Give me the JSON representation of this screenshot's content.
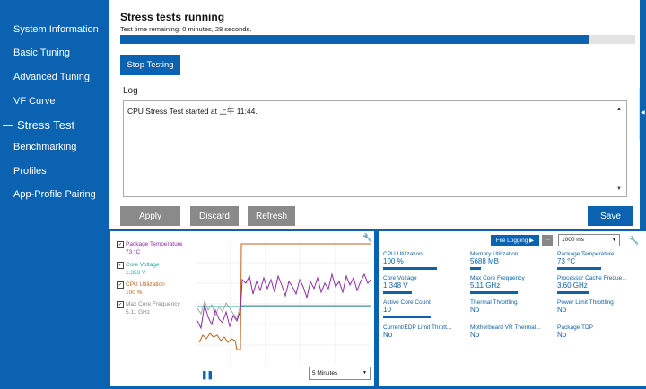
{
  "sidebar": {
    "items": [
      {
        "label": "System Information"
      },
      {
        "label": "Basic Tuning"
      },
      {
        "label": "Advanced Tuning"
      },
      {
        "label": "VF Curve"
      },
      {
        "label": "Stress Test",
        "active": true
      },
      {
        "label": "Benchmarking"
      },
      {
        "label": "Profiles"
      },
      {
        "label": "App-Profile Pairing"
      }
    ]
  },
  "main": {
    "title": "Stress tests running",
    "subtitle": "Test time remaining: 0 minutes, 28 seconds.",
    "progress": 0.91,
    "stop_button": "Stop Testing",
    "log_label": "Log",
    "log_text": "CPU Stress Test started at 上午 11:44."
  },
  "actions": {
    "apply": "Apply",
    "discard": "Discard",
    "refresh": "Refresh",
    "save": "Save"
  },
  "graph": {
    "legend": [
      {
        "name": "Package Temperature",
        "value": "73 °C",
        "color": "#8e2ea3"
      },
      {
        "name": "Core Voltage",
        "value": "1.353 V",
        "color": "#2aa6a0"
      },
      {
        "name": "CPU Utilization",
        "value": "100 %",
        "color": "#c0621c"
      },
      {
        "name": "Max Core Frequency",
        "value": "5.11 GHz",
        "color": "#888888"
      }
    ],
    "duration": "5 Minutes",
    "icons": {
      "pause": "pause-icon",
      "settings": "wrench-icon"
    }
  },
  "sensors": {
    "file_logging": "File Logging ▶",
    "more": "...",
    "interval": "1000 ms",
    "items": [
      {
        "label": "CPU Utilization",
        "value": "100 %",
        "bar": 0.85
      },
      {
        "label": "Memory Utilization",
        "value": "5688  MB",
        "bar": 0.17
      },
      {
        "label": "Package Temperature",
        "value": "73 °C",
        "bar": 0.7
      },
      {
        "label": "Core Voltage",
        "value": "1.348 V",
        "bar": 0.45
      },
      {
        "label": "Max Core Frequency",
        "value": "5.11 GHz",
        "bar": 0.75
      },
      {
        "label": "Processor Cache Freque...",
        "value": "3.60 GHz",
        "bar": 0.5
      },
      {
        "label": "Active Core Count",
        "value": "10",
        "bar": 0.75
      },
      {
        "label": "Thermal Throttling",
        "value": "No",
        "bar": 0
      },
      {
        "label": "Power Limit Throttling",
        "value": "No",
        "bar": 0
      },
      {
        "label": "Current/EDP Limit Thrott...",
        "value": "No",
        "bar": 0
      },
      {
        "label": "Motherboard VR Thermal...",
        "value": "No",
        "bar": 0
      },
      {
        "label": "Package TDP",
        "value": "No",
        "bar": 0
      }
    ]
  }
}
